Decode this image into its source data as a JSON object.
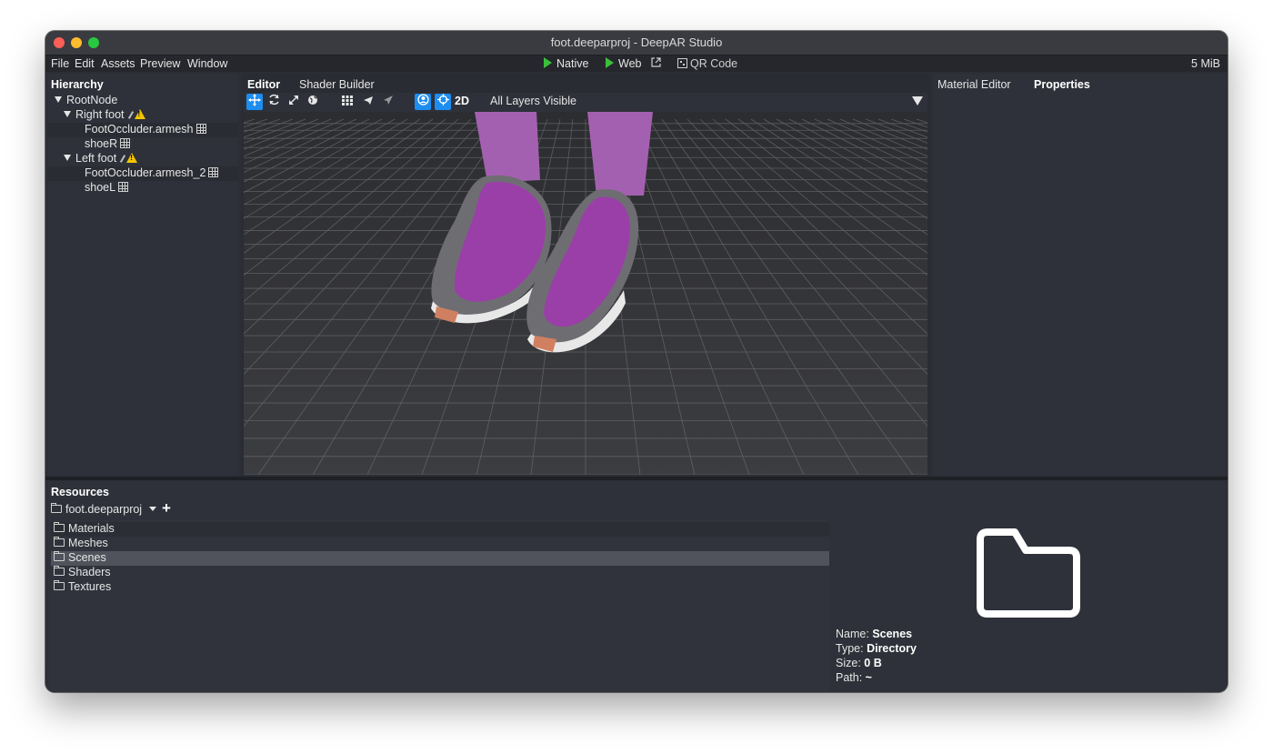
{
  "window": {
    "title": "foot.deeparproj - DeepAR Studio"
  },
  "menu": {
    "items": [
      "File",
      "Edit",
      "Assets",
      "Preview",
      "Window"
    ],
    "native": "Native",
    "web": "Web",
    "qr": "QR Code",
    "memory": "5 MiB"
  },
  "hierarchy": {
    "title": "Hierarchy",
    "nodes": [
      "RootNode",
      "Right foot",
      "FootOccluder.armesh",
      "shoeR",
      "Left foot",
      "FootOccluder.armesh_2",
      "shoeL"
    ]
  },
  "editor": {
    "tabs": [
      "Editor",
      "Shader Builder"
    ],
    "mode_2d": "2D",
    "layers": "All Layers Visible"
  },
  "right_panel": {
    "tabs": [
      "Material Editor",
      "Properties"
    ]
  },
  "resources": {
    "title": "Resources",
    "project": "foot.deeparproj",
    "folders": [
      "Materials",
      "Meshes",
      "Scenes",
      "Shaders",
      "Textures"
    ],
    "selected_index": 2,
    "info": {
      "name_label": "Name:",
      "name": "Scenes",
      "type_label": "Type:",
      "type": "Directory",
      "size_label": "Size:",
      "size": "0 B",
      "path_label": "Path:",
      "path": "~"
    }
  },
  "colors": {
    "accent": "#1d8df0",
    "play": "#3bbf3b",
    "warn": "#f2c500",
    "panel": "#2e3139",
    "shoe": "#9a3fa8"
  }
}
